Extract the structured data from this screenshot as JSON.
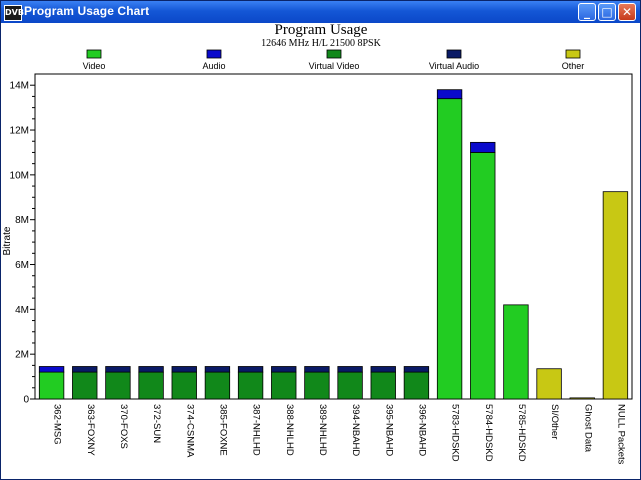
{
  "window": {
    "title": "Program Usage Chart",
    "icon_text": "DVB",
    "buttons": {
      "minimize": "_",
      "maximize": "□",
      "close": "✕"
    }
  },
  "chart_data": {
    "type": "bar",
    "title": "Program Usage",
    "subtitle": "12646 MHz H/L 21500 8PSK",
    "ylabel": "Bitrate",
    "xlabel": "",
    "ylim": [
      0,
      14.5
    ],
    "yticks": [
      0,
      2,
      4,
      6,
      8,
      10,
      12,
      14
    ],
    "ytick_labels": [
      "0",
      "2M",
      "4M",
      "6M",
      "8M",
      "10M",
      "12M",
      "14M"
    ],
    "grid": false,
    "legend_position": "top",
    "legend": [
      {
        "name": "Video",
        "color": "#22cc22"
      },
      {
        "name": "Audio",
        "color": "#0a0acc"
      },
      {
        "name": "Virtual Video",
        "color": "#11881a"
      },
      {
        "name": "Virtual Audio",
        "color": "#0a1a66"
      },
      {
        "name": "Other",
        "color": "#c8c814"
      }
    ],
    "categories": [
      "362-MSG",
      "363-FOXNY",
      "370-FOXS",
      "372-SUN",
      "374-CSNMA",
      "385-FOXNE",
      "387-NHLHD",
      "388-NHLHD",
      "389-NHLHD",
      "394-NBAHD",
      "395-NBAHD",
      "396-NBAHD",
      "5783-HDSKD",
      "5784-HDSKD",
      "5785-HDSKD",
      "SI/Other",
      "Ghost Data",
      "NULL Packets"
    ],
    "series": [
      {
        "name": "Video",
        "color": "#22cc22",
        "values": [
          1.2,
          0,
          0,
          0,
          0,
          0,
          0,
          0,
          0,
          0,
          0,
          0,
          13.4,
          11.0,
          4.2,
          0,
          0,
          0
        ]
      },
      {
        "name": "Audio",
        "color": "#0a0acc",
        "values": [
          0.25,
          0,
          0,
          0,
          0,
          0,
          0,
          0,
          0,
          0,
          0,
          0,
          0.4,
          0.45,
          0,
          0,
          0,
          0
        ]
      },
      {
        "name": "Virtual Video",
        "color": "#11881a",
        "values": [
          0,
          1.2,
          1.2,
          1.2,
          1.2,
          1.2,
          1.2,
          1.2,
          1.2,
          1.2,
          1.2,
          1.2,
          0,
          0,
          0,
          0,
          0,
          0
        ]
      },
      {
        "name": "Virtual Audio",
        "color": "#0a1a66",
        "values": [
          0,
          0.25,
          0.25,
          0.25,
          0.25,
          0.25,
          0.25,
          0.25,
          0.25,
          0.25,
          0.25,
          0.25,
          0,
          0,
          0,
          0,
          0,
          0
        ]
      },
      {
        "name": "Other",
        "color": "#c8c814",
        "values": [
          0,
          0,
          0,
          0,
          0,
          0,
          0,
          0,
          0,
          0,
          0,
          0,
          0,
          0,
          0,
          1.35,
          0.05,
          9.25
        ]
      }
    ]
  }
}
